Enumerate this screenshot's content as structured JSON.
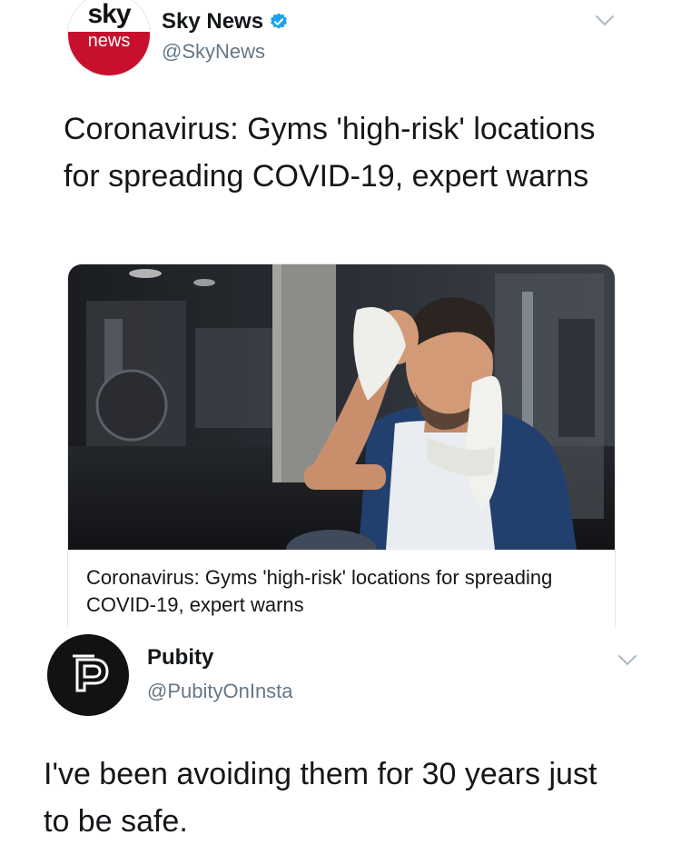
{
  "tweet1": {
    "avatar": {
      "top_text": "sky",
      "bottom_text": "news"
    },
    "display_name": "Sky News",
    "handle": "@SkyNews",
    "text": "Coronavirus: Gyms 'high-risk' locations for spreading COVID-19, expert warns",
    "card": {
      "title": "Coronavirus: Gyms 'high-risk' locations for spreading COVID-19, expert warns"
    }
  },
  "tweet2": {
    "display_name": "Pubity",
    "handle": "@PubityOnInsta",
    "text": "I've been avoiding them for 30 years just to be safe."
  },
  "colors": {
    "verified": "#1da1f2",
    "sky_red": "#c8102e",
    "handle_gray": "#657786"
  },
  "icons": [
    "verified-badge-icon",
    "chevron-down-icon",
    "pubity-logo-icon"
  ]
}
